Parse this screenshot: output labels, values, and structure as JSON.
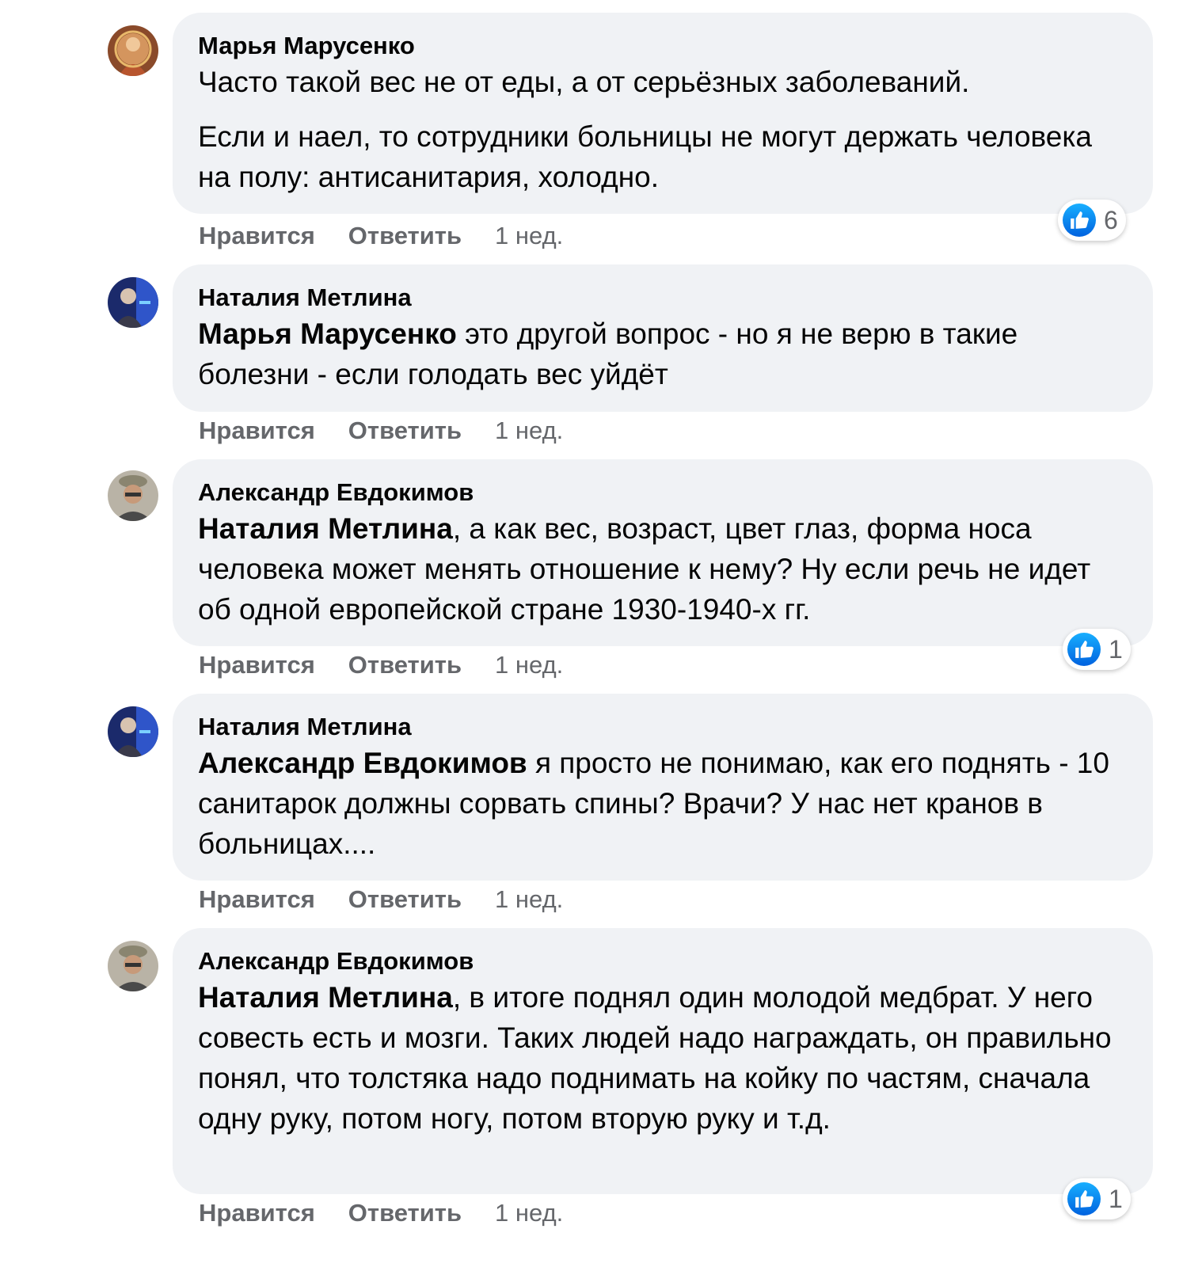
{
  "comments": [
    {
      "author": "Марья Марусенко",
      "mention": "",
      "paragraphs": [
        "Часто такой вес не от еды, а от серьёзных заболеваний.",
        "Если и наел, то сотрудники больницы не могут держать человека на полу: антисанитария, холодно."
      ],
      "like_label": "Нравится",
      "reply_label": "Ответить",
      "time": "1 нед.",
      "reaction_icon": "like-icon",
      "reaction_count": "6"
    },
    {
      "author": "Наталия Метлина",
      "mention": "Марья Марусенко",
      "paragraphs": [
        " это другой вопрос - но я не верю в такие болезни - если голодать вес уйдёт"
      ],
      "like_label": "Нравится",
      "reply_label": "Ответить",
      "time": "1 нед."
    },
    {
      "author": "Александр Евдокимов",
      "mention": "Наталия Метлина",
      "paragraphs": [
        ", а как вес, возраст, цвет глаз, форма носа человека может менять отношение к нему? Ну если речь не идет об одной европейской стране 1930-1940-х гг."
      ],
      "like_label": "Нравится",
      "reply_label": "Ответить",
      "time": "1 нед.",
      "reaction_icon": "like-icon",
      "reaction_count": "1"
    },
    {
      "author": "Наталия Метлина",
      "mention": "Александр Евдокимов",
      "paragraphs": [
        " я просто не понимаю, как его поднять - 10 санитарок должны сорвать спины? Врачи? У нас нет кранов в больницах...."
      ],
      "like_label": "Нравится",
      "reply_label": "Ответить",
      "time": "1 нед."
    },
    {
      "author": "Александр Евдокимов",
      "mention": "Наталия Метлина",
      "paragraphs": [
        ", в итоге поднял один молодой медбрат. У него совесть есть и мозги. Таких людей надо награждать, он правильно понял, что толстяка надо поднимать на койку по частям, сначала одну руку, потом ногу, потом вторую руку и т.д."
      ],
      "like_label": "Нравится",
      "reply_label": "Ответить",
      "time": "1 нед.",
      "reaction_icon": "like-icon",
      "reaction_count": "1"
    }
  ],
  "colors": {
    "bubble": "#f0f2f5",
    "muted_text": "#65676b",
    "like_blue": "#1877f2"
  }
}
